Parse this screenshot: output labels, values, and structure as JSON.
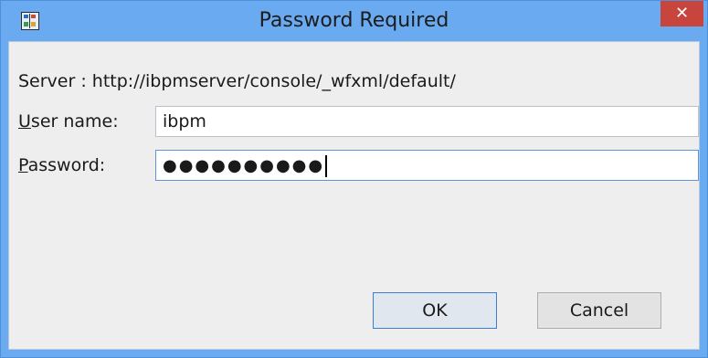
{
  "window": {
    "title": "Password Required",
    "close_label": "✕"
  },
  "server": {
    "text": "Server : http://ibpmserver/console/_wfxml/default/"
  },
  "user_name": {
    "label_mnemonic": "U",
    "label_rest": "ser name:",
    "value": "ibpm"
  },
  "password": {
    "label_mnemonic": "P",
    "label_rest": "assword:",
    "masked_value": "●●●●●●●●●●"
  },
  "buttons": {
    "ok_label": "OK",
    "cancel_label": "Cancel"
  },
  "colors": {
    "title_bar": "#6aaaf0",
    "close_button": "#c7453c",
    "dialog_body": "#eeeeee",
    "default_button_border": "#3c7fd1"
  },
  "icons": {
    "app": "java-app-icon",
    "close": "close-icon"
  }
}
